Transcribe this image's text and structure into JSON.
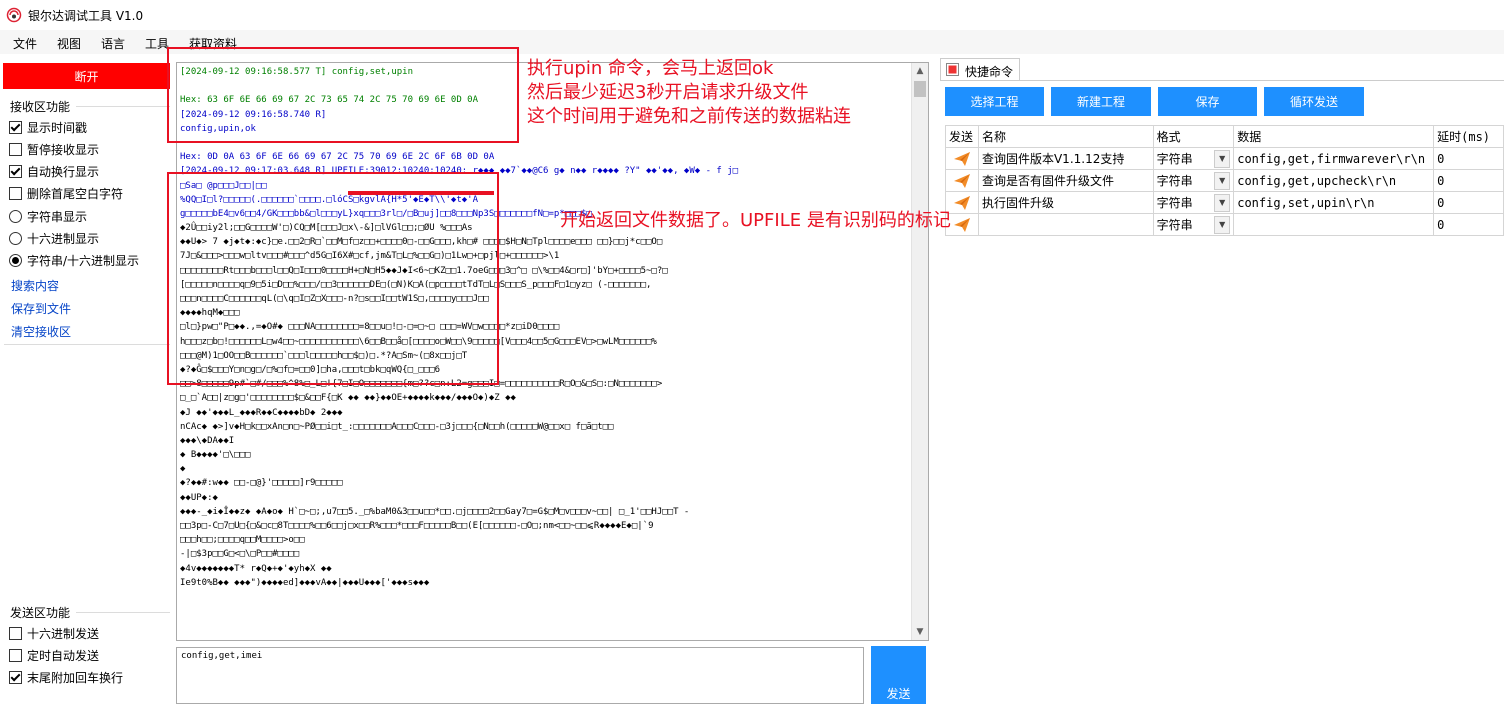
{
  "window": {
    "title": "银尔达调试工具 V1.0"
  },
  "menu": [
    "文件",
    "视图",
    "语言",
    "工具",
    "获取资料"
  ],
  "left": {
    "disconnect_label": "断开",
    "receive_group": "接收区功能",
    "receive_options": [
      {
        "label": "显示时间戳",
        "kind": "checkbox",
        "checked": true
      },
      {
        "label": "暂停接收显示",
        "kind": "checkbox",
        "checked": false
      },
      {
        "label": "自动换行显示",
        "kind": "checkbox",
        "checked": true
      },
      {
        "label": "删除首尾空白字符",
        "kind": "checkbox",
        "checked": false
      },
      {
        "label": "字符串显示",
        "kind": "radio",
        "checked": false
      },
      {
        "label": "十六进制显示",
        "kind": "radio",
        "checked": false
      },
      {
        "label": "字符串/十六进制显示",
        "kind": "radio",
        "checked": true
      }
    ],
    "links": [
      "搜索内容",
      "保存到文件",
      "清空接收区"
    ],
    "send_group": "发送区功能",
    "send_options": [
      {
        "label": "十六进制发送",
        "checked": false
      },
      {
        "label": "定时自动发送",
        "checked": false
      },
      {
        "label": "末尾附加回车换行",
        "checked": true
      }
    ]
  },
  "receive_lines": [
    {
      "c": "g",
      "t": "[2024-09-12 09:16:58.577 T] config,set,upin"
    },
    {
      "c": "g",
      "t": ""
    },
    {
      "c": "g",
      "t": "Hex: 63 6F 6E 66 69 67 2C 73 65 74 2C 75 70 69 6E 0D 0A"
    },
    {
      "c": "b",
      "t": "[2024-09-12 09:16:58.740 R]"
    },
    {
      "c": "b",
      "t": "config,upin,ok"
    },
    {
      "c": "b",
      "t": ""
    },
    {
      "c": "b",
      "t": "Hex: 0D 0A 63 6F 6E 66 69 67 2C 75 70 69 6E 2C 6F 6B 0D 0A"
    },
    {
      "c": "b",
      "t": "[2024-09-12 09:17:03.648 R] UPFILE:39012:10240:10240:  r◆◆◆  ◆◆7`◆◆@C6  g◆  n◆◆  r◆◆◆◆  ?Y\"   ◆◆'◆◆,  ◆W◆  -  f  j□"
    },
    {
      "c": "b",
      "t": "          □Sa□ @p□□□J□□|□□"
    },
    {
      "c": "b",
      "t": "%QQ□I□l?□□□□□(.□□□□□□`□□□□.□lóCS□kgvlA{H*5'◆E◆T\\\\'◆t◆'A"
    },
    {
      "c": "b",
      "t": "g□□□□□bE4□v6□□4/GK□□□bb&□l□□□yL}xq□□□3rl□/□B□uj]□□8□□□Np3S□□□□□□□fN□=p*□□□$□"
    },
    {
      "c": "k",
      "t": "◆2Û□□iy2l;□□G□□□□W'□)CQ□M[□□□J□x\\-&]□lVGl□□;□ØU %□□□As"
    },
    {
      "c": "k",
      "t": "◆◆U◆>  7  ◆j◆t◆:◆c}□e.□□2□R□`□□M□f□z□□+□□□□0□-□□G□□□,kh□# □□□□$H□N□Tpl□□□□e□□□  □□}□□j*c□□O□"
    },
    {
      "c": "k",
      "t": "7J□&□□□>□□□w□ltv□□□#□□□^d5G□I6X#□cf,jm&T□L□%□□G□)□1Lw□+□pjl□+□□□□□□>\\1"
    },
    {
      "c": "k",
      "t": "□□□□□□□□Rt□□□b□□□l□□Q□I□□□0□□□□H+□N□H5◆◆J◆I<6~□KZ□□1.7oeG□□□3□^□    □\\%□□4&□r□]'bY□+□□□□5~□?□"
    },
    {
      "c": "k",
      "t": "[□□□□□n□□□□q□9□5i□D□□%□□□/□□3□□□□□□DE□(□N)K□A(□p□□□□tTdT□L□S□□□S_p□□□F□1□yz□    (-□□□□□□□,"
    },
    {
      "c": "k",
      "t": "□□□n□□□□C□□□□□□qL(□\\q□I□Z□X□□□-n?□s□□I□□tW1S□,□□□□y□□□J□□"
    },
    {
      "c": "k",
      "t": "◆◆◆◆hqM◆□□□"
    },
    {
      "c": "k",
      "t": "□l□}pw□\"P□◆◆.,=◆O#◆ □□□NA□□□□□□□□=8□□u□!□-□=□~□ □□□=WV□w□□□□*z□iD0□□□□"
    },
    {
      "c": "k",
      "t": "h□□□z□b□!□□□□□□L□w4□□~□□□□□□□□□□□\\6□□B□□å□[□□□□o□W□□\\9□□□□□[V□□□4□□5□G□□□EV□>□wLM□□□□□□%"
    },
    {
      "c": "k",
      "t": "□□□@M)1□OO□□B□□□□□□`□□□l□□□□□h□□$□)□.*?A□Sm~(□8x□□j□T"
    },
    {
      "c": "k",
      "t": "◆?◆Ĝ□$□□□Y□n□g□/□%□f□=□□0]□ha,□□□t□bk□qWQ{□_□□□6"
    },
    {
      "c": "k",
      "t": "□□>8□□□□□9p#`□#/□□□%^8%□_L□!{7□I□O□□□□□□□{m□??c□n:L2=g□□□I□=□□□□□□□□□□R□O□&□S□:□N□□□□□□□>"
    },
    {
      "c": "k",
      "t": "□_□`A□□|z□g□'□□□□□□□□$□&□□F{□K  ◆◆  ◆◆}◆◆OE+◆◆◆◆k◆◆◆/◆◆◆O◆)◆Z  ◆◆"
    },
    {
      "c": "k",
      "t": "◆J  ◆◆'◆◆◆L_◆◆◆R◆◆C◆◆◆◆bD◆  2◆◆◆"
    },
    {
      "c": "k",
      "t": "nCAc◆  ◆>]v◆H□k□□xAn□n□~PØ□□i□t_:□□□□□□□A□□□C□□□-□3j□□□{□N□□h(□□□□□W@□□x□      f□ã□t□□"
    },
    {
      "c": "k",
      "t": "◆◆◆\\◆DA◆◆I"
    },
    {
      "c": "k",
      "t": "◆  B◆◆◆◆'□\\□□□"
    },
    {
      "c": "k",
      "t": "◆"
    },
    {
      "c": "k",
      "t": "◆?◆◆#:w◆◆   □□-□@}'□□□□□]r9□□□□□"
    },
    {
      "c": "k",
      "t": "◆◆UP◆:◆"
    },
    {
      "c": "k",
      "t": "◆◆◆-_◆i◆Î◆◆z◆ ◆A◆o◆  H`□~□;,u7□□5._□%baM0&3□□u□□*□□.□j□□□□2□□Gay7□=G$□M□v□□□v~□□|    □_1'□□HJ□□T   -"
    },
    {
      "c": "k",
      "t": "□□3p□-C□7□U□{□&□c□8T□□□□%□□6□□j□x□□R%□□□*□□□F□□□□□B□□(E[□□□□□□-□O□;nm<□□~□□⩽R◆◆◆◆E◆□|`9"
    },
    {
      "c": "k",
      "t": "□□□h□□;□□□□q□□M□□□□>o□□"
    },
    {
      "c": "k",
      "t": "-|□$3p□□G□<□\\□P□□#□□□□"
    },
    {
      "c": "k",
      "t": "◆4v◆◆◆◆◆◆◆T* r◆Q◆+◆'◆yh◆X  ◆◆"
    },
    {
      "c": "k",
      "t": "Ie9t0%B◆◆  ◆◆◆\")◆◆◆◆ed]◆◆◆vA◆◆|◆◆◆U◆◆◆['◆◆◆s◆◆◆"
    }
  ],
  "send": {
    "input_value": "config,get,imei",
    "button_label": "发送"
  },
  "quick": {
    "tab_label": "快捷命令",
    "buttons": [
      "选择工程",
      "新建工程",
      "保存",
      "循环发送"
    ],
    "headers": [
      "发送",
      "名称",
      "格式",
      "数据",
      "延时(ms)"
    ],
    "rows": [
      {
        "name": "查询固件版本V1.1.12支持",
        "format": "字符串",
        "data": "config,get,firmwarever\\r\\n",
        "delay": "0"
      },
      {
        "name": "查询是否有固件升级文件",
        "format": "字符串",
        "data": "config,get,upcheck\\r\\n",
        "delay": "0"
      },
      {
        "name": "执行固件升级",
        "format": "字符串",
        "data": "config,set,upin\\r\\n",
        "delay": "0"
      },
      {
        "name": "",
        "format": "字符串",
        "data": "",
        "delay": "0"
      }
    ]
  },
  "annotations": {
    "note1": [
      "执行upin 命令，会马上返回ok",
      "然后最少延迟3秒开启请求升级文件",
      "这个时间用于避免和之前传送的数据粘连"
    ],
    "note2": "开始返回文件数据了。UPFILE 是有识别码的标记"
  },
  "colors": {
    "accent": "#1e90ff",
    "disconnect": "#ff0000",
    "annotation": "#e81123",
    "tx_text": "#008000",
    "rx_text": "#0000c8"
  }
}
